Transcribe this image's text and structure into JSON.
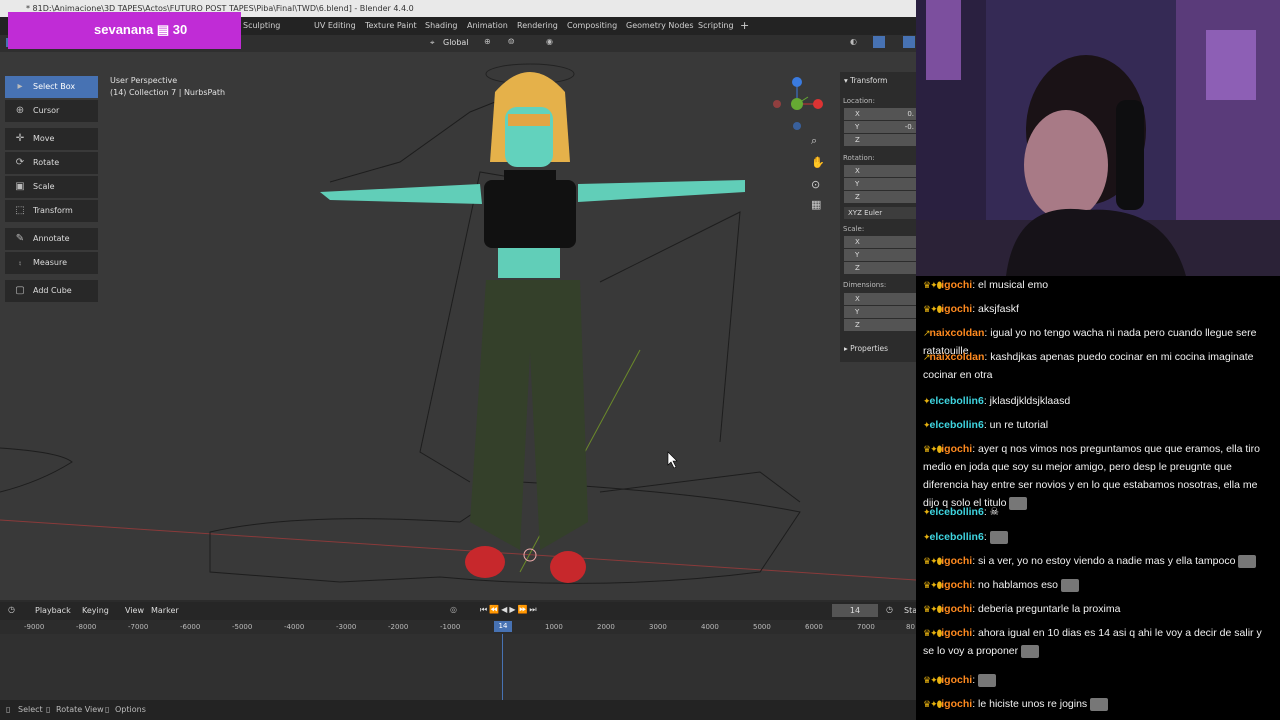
{
  "overlay": {
    "text": "sevanana ▤ 30",
    "bg": "#c02cd6"
  },
  "window": {
    "title": "* 81D:\\Animacione\\3D TAPES\\Actos\\FUTURO POST TAPES\\Piba\\Final\\TWD\\6.blend] - Blender 4.4.0"
  },
  "workspaces": [
    "Sculpting",
    "UV Editing",
    "Texture Paint",
    "Shading",
    "Animation",
    "Rendering",
    "Compositing",
    "Geometry Nodes",
    "Scripting",
    "+"
  ],
  "header": {
    "orientation": "Global"
  },
  "viewport": {
    "view_name": "User Perspective",
    "collection_info": "(14) Collection 7 | NurbsPath"
  },
  "tools": [
    {
      "label": "Select Box",
      "icon": "select-box-icon",
      "active": true
    },
    {
      "label": "Cursor",
      "icon": "cursor-icon"
    },
    {
      "label": "Move",
      "icon": "move-icon"
    },
    {
      "label": "Rotate",
      "icon": "rotate-icon"
    },
    {
      "label": "Scale",
      "icon": "scale-icon"
    },
    {
      "label": "Transform",
      "icon": "transform-icon"
    },
    {
      "label": "Annotate",
      "icon": "annotate-icon"
    },
    {
      "label": "Measure",
      "icon": "measure-icon"
    },
    {
      "label": "Add Cube",
      "icon": "add-cube-icon"
    }
  ],
  "npanel": {
    "transform": "Transform",
    "location": "Location:",
    "loc": [
      {
        "axis": "X",
        "value": "0."
      },
      {
        "axis": "Y",
        "value": "-0."
      },
      {
        "axis": "Z",
        "value": ""
      }
    ],
    "rotation": "Rotation:",
    "rot": [
      {
        "axis": "X"
      },
      {
        "axis": "Y"
      },
      {
        "axis": "Z"
      }
    ],
    "rot_mode": "XYZ Euler",
    "scale": "Scale:",
    "scl": [
      {
        "axis": "X"
      },
      {
        "axis": "Y"
      },
      {
        "axis": "Z"
      }
    ],
    "dimensions": "Dimensions:",
    "dim": [
      {
        "axis": "X"
      },
      {
        "axis": "Y"
      },
      {
        "axis": "Z"
      }
    ],
    "properties": "Properties"
  },
  "timeline": {
    "playback": "Playback",
    "keying": "Keying",
    "view": "View",
    "marker": "Marker",
    "current_frame": "14",
    "start_label": "Sta",
    "ticks": [
      "-9000",
      "-8000",
      "-7000",
      "-6000",
      "-5000",
      "-4000",
      "-3000",
      "-2000",
      "-1000",
      "14",
      "1000",
      "2000",
      "3000",
      "4000",
      "5000",
      "6000",
      "7000",
      "80"
    ]
  },
  "statusbar": {
    "select": "Select",
    "rotate_view": "Rotate View",
    "options": "Options"
  },
  "chat": [
    {
      "user": "igochi",
      "text": ": el musical emo",
      "color": "#ff8a1f",
      "badges": "♛✦⬮"
    },
    {
      "user": "igochi",
      "text": ": aksjfaskf",
      "color": "#ff8a1f",
      "badges": "♛✦⬮"
    },
    {
      "user": "naixcoldan",
      "text": ": igual yo no tengo wacha ni nada pero cuando llegue sere ratatouille",
      "color": "#ff8a1f",
      "badges": "↗"
    },
    {
      "user": "naixcoldan",
      "text": ": kashdjkas apenas puedo cocinar en mi cocina imaginate cocinar en otra",
      "color": "#ff8a1f",
      "badges": "↗"
    },
    {
      "user": "elcebollin6",
      "text": ": jklasdjkldsjklaasd",
      "color": "#3fd5e0",
      "badges": "✦"
    },
    {
      "user": "elcebollin6",
      "text": ": un re tutorial",
      "color": "#3fd5e0",
      "badges": "✦"
    },
    {
      "user": "igochi",
      "text": ": ayer q nos vimos nos preguntamos que que eramos, ella tiro medio en joda que soy su mejor amigo, pero desp le preugnte que diferencia hay entre ser novios y en lo que estabamos nosotras, ella me dijo q solo el titulo",
      "color": "#ff8a1f",
      "badges": "♛✦⬮"
    },
    {
      "user": "elcebollin6",
      "text": ": ☠",
      "color": "#3fd5e0",
      "badges": "✦"
    },
    {
      "user": "elcebollin6",
      "text": ":",
      "color": "#3fd5e0",
      "badges": "✦"
    },
    {
      "user": "igochi",
      "text": ": si a ver, yo no estoy viendo a nadie mas y ella tampoco",
      "color": "#ff8a1f",
      "badges": "♛✦⬮"
    },
    {
      "user": "igochi",
      "text": ": no hablamos eso",
      "color": "#ff8a1f",
      "badges": "♛✦⬮"
    },
    {
      "user": "igochi",
      "text": ": deberia preguntarle la proxima",
      "color": "#ff8a1f",
      "badges": "♛✦⬮"
    },
    {
      "user": "igochi",
      "text": ": ahora igual en 10 dias es 14 asi q ahi le voy a decir de salir y se lo voy a proponer",
      "color": "#ff8a1f",
      "badges": "♛✦⬮"
    },
    {
      "user": "igochi",
      "text": ":",
      "color": "#ff8a1f",
      "badges": "♛✦⬮"
    },
    {
      "user": "igochi",
      "text": ": le hiciste unos re jogins",
      "color": "#ff8a1f",
      "badges": "♛✦⬮"
    }
  ]
}
